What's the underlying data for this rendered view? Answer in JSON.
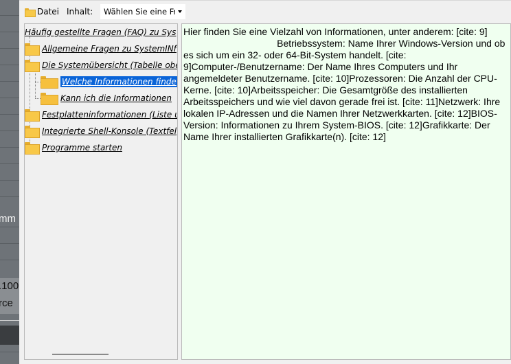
{
  "background": {
    "texts": [
      "mm",
      ".100",
      "rce"
    ]
  },
  "toolbar": {
    "file_label": "Datei",
    "content_label": "Inhalt:",
    "select_value": "Wählen Sie eine Fr"
  },
  "tree": {
    "items": [
      {
        "label": "Häufig gestellte Fragen (FAQ) zu Sys",
        "level": 0,
        "icon": "none"
      },
      {
        "label": "Allgemeine Fragen zu SystemINf",
        "level": 1,
        "icon": "folder-icon"
      },
      {
        "label": "Die Systemübersicht (Tabelle obe",
        "level": 1,
        "icon": "folder-icon"
      },
      {
        "label": "Welche Informationen finde",
        "level": 2,
        "icon": "open-folder-icon",
        "selected": true
      },
      {
        "label": "Kann ich die Informationen",
        "level": 2,
        "icon": "open-folder-icon"
      },
      {
        "label": "Festplatteninformationen (Liste u",
        "level": 1,
        "icon": "folder-icon"
      },
      {
        "label": "Integrierte Shell-Konsole (Textfel",
        "level": 1,
        "icon": "folder-icon"
      },
      {
        "label": "Programme starten",
        "level": 1,
        "icon": "folder-icon"
      }
    ]
  },
  "content": {
    "text": "Hier finden Sie eine Vielzahl von Informationen, unter anderem: [cite: 9]\n                                   Betriebssystem: Name Ihrer Windows-Version und ob es sich um ein 32- oder 64-Bit-System handelt. [cite: 9]Computer-/Benutzername: Der Name Ihres Computers und Ihr angemeldeter Benutzername. [cite: 10]Prozessoren: Die Anzahl der CPU-Kerne. [cite: 10]Arbeitsspeicher: Die Gesamtgröße des installierten Arbeitsspeichers und wie viel davon gerade frei ist. [cite: 11]Netzwerk: Ihre lokalen IP-Adressen und die Namen Ihrer Netzwerkkarten. [cite: 12]BIOS-Version: Informationen zu Ihrem System-BIOS. [cite: 12]Grafikkarte: Der Name Ihrer installierten Grafikkarte(n). [cite: 12]"
  },
  "colors": {
    "selection": "#0a64d8",
    "content_bg": "#f0fff0",
    "folder": "#f8c848"
  }
}
